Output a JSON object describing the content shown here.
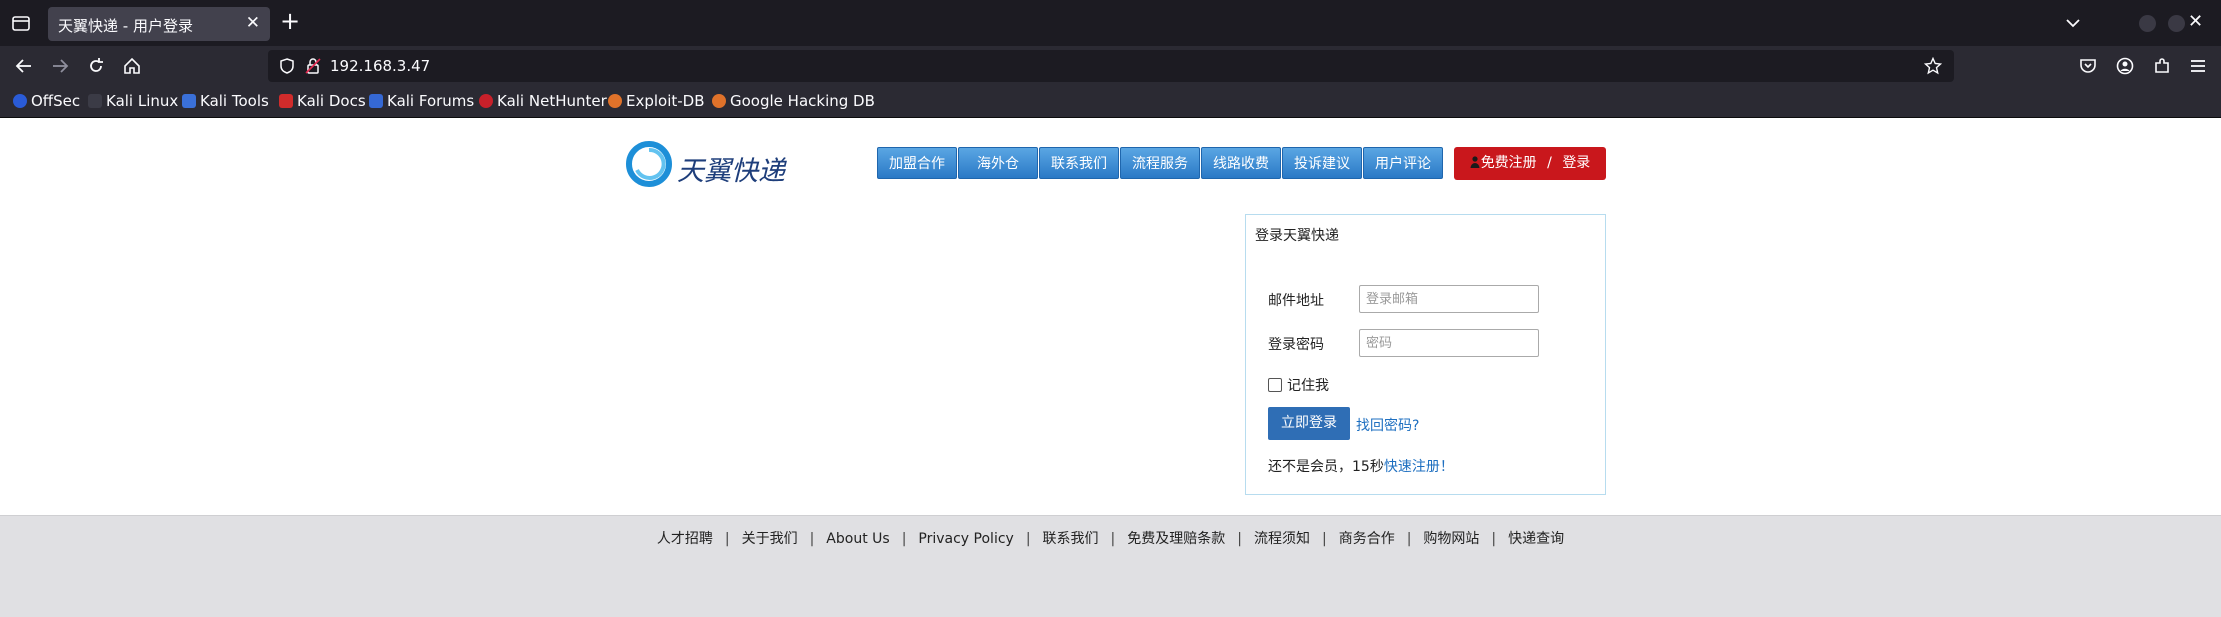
{
  "browser": {
    "tab_title": "天翼快递 - 用户登录",
    "tab_close": "✕",
    "new_tab": "+",
    "url": "192.168.3.47",
    "window_close": "✕",
    "bookmarks": [
      "OffSec",
      "Kali Linux",
      "Kali Tools",
      "Kali Docs",
      "Kali Forums",
      "Kali NetHunter",
      "Exploit-DB",
      "Google Hacking DB"
    ]
  },
  "header": {
    "logo_text": "天翼快递",
    "menu": [
      "加盟合作",
      "海外仓",
      "联系我们",
      "流程服务",
      "线路收费",
      "投诉建议",
      "用户评论"
    ],
    "register_label": "免费注册",
    "register_sep": "/",
    "login_label": "登录"
  },
  "login": {
    "title": "登录天翼快递",
    "email_label": "邮件地址",
    "email_placeholder": "登录邮箱",
    "password_label": "登录密码",
    "password_placeholder": "密码",
    "remember_label": "记住我",
    "submit_label": "立即登录",
    "forgot_label": "找回密码?",
    "member_prefix": "还不是会员，15秒",
    "member_link": "快速注册！"
  },
  "footer": {
    "links": [
      "人才招聘",
      "关于我们",
      "About Us",
      "Privacy Policy",
      "联系我们",
      "免费及理赔条款",
      "流程须知",
      "商务合作",
      "购物网站",
      "快递查询"
    ],
    "separator": "|"
  },
  "colors": {
    "menu_blue": "#2a79c6",
    "register_red": "#c9171c",
    "login_button": "#2f6eb5",
    "link": "#1e6fc0"
  }
}
